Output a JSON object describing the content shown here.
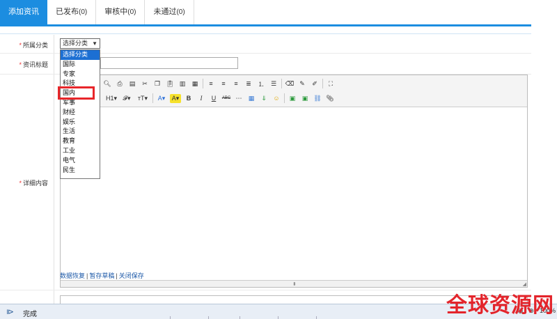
{
  "tabs": [
    {
      "label": "添加资讯",
      "count": "",
      "active": true
    },
    {
      "label": "已发布",
      "count": "(0)",
      "active": false
    },
    {
      "label": "审核中",
      "count": "(0)",
      "active": false
    },
    {
      "label": "未通过",
      "count": "(0)",
      "active": false
    }
  ],
  "form": {
    "category_label": "所属分类",
    "title_label": "资讯标题",
    "content_label": "详细内容",
    "required_mark": "*",
    "category_selected": "选择分类",
    "category_options": [
      "选择分类",
      "国际",
      "专家",
      "科技",
      "国内",
      "军事",
      "财经",
      "娱乐",
      "生活",
      "教育",
      "工业",
      "电气",
      "民生"
    ],
    "highlighted_option": "国内"
  },
  "editor": {
    "toolbar_row2_labels": [
      "H1▾",
      "𝓕▾",
      "тT▾",
      "A▾",
      "A▾",
      "B",
      "I",
      "U",
      "ABC"
    ],
    "links": [
      "数据恢复",
      "暂存草稿",
      "关闭保存"
    ],
    "link_separator": "|"
  },
  "statusbar": {
    "text": "完成",
    "zoom": "100%"
  },
  "watermark": "全球资源网",
  "colors": {
    "accent": "#1c8de0",
    "highlight": "#e8262a",
    "required": "#e33333",
    "link": "#1e5aa8"
  }
}
